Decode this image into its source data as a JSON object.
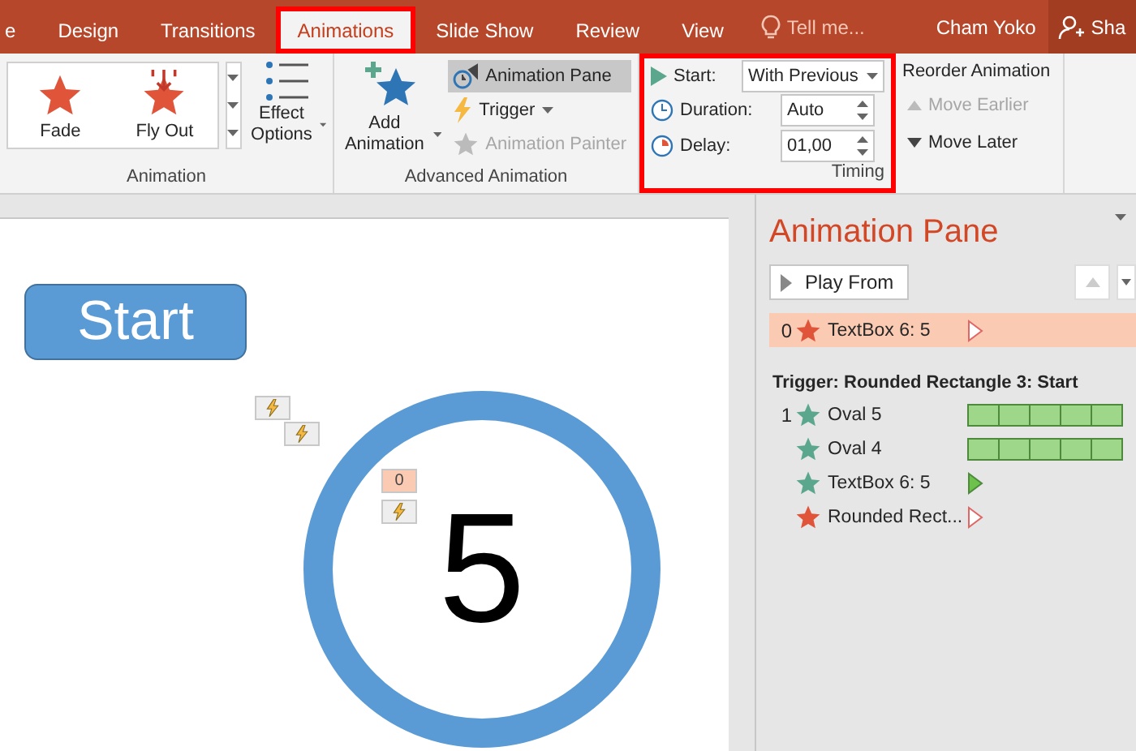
{
  "tabs": [
    {
      "label": "e",
      "selected": false,
      "highlighted": false
    },
    {
      "label": "Design",
      "selected": false,
      "highlighted": false
    },
    {
      "label": "Transitions",
      "selected": false,
      "highlighted": false
    },
    {
      "label": "Animations",
      "selected": true,
      "highlighted": true
    },
    {
      "label": "Slide Show",
      "selected": false,
      "highlighted": false
    },
    {
      "label": "Review",
      "selected": false,
      "highlighted": false
    },
    {
      "label": "View",
      "selected": false,
      "highlighted": false
    }
  ],
  "tell_me": {
    "placeholder": "Tell me..."
  },
  "user": "Cham Yoko",
  "share": "Sha",
  "animation_group": {
    "label": "Animation",
    "effects": [
      {
        "label": "Fade"
      },
      {
        "label": "Fly Out"
      }
    ],
    "effect_options": "Effect Options"
  },
  "advanced": {
    "label": "Advanced Animation",
    "add": "Add Animation",
    "items": [
      {
        "label": "Animation Pane",
        "selected": true,
        "disabled": false,
        "has_menu": false
      },
      {
        "label": "Trigger",
        "selected": false,
        "disabled": false,
        "has_menu": true
      },
      {
        "label": "Animation Painter",
        "selected": false,
        "disabled": true,
        "has_menu": false
      }
    ]
  },
  "timing": {
    "label": "Timing",
    "highlighted": true,
    "start": {
      "label": "Start:",
      "value": "With Previous"
    },
    "duration": {
      "label": "Duration:",
      "value": "Auto"
    },
    "delay": {
      "label": "Delay:",
      "value": "01,00"
    }
  },
  "reorder": {
    "title": "Reorder Animation",
    "items": [
      {
        "label": "Move Earlier",
        "disabled": true
      },
      {
        "label": "Move Later",
        "disabled": false
      }
    ]
  },
  "slide": {
    "button": "Start",
    "tag": "0",
    "number": "5"
  },
  "pane": {
    "title": "Animation Pane",
    "play": "Play From",
    "items": [
      {
        "number": "0",
        "name": "TextBox 6: 5",
        "color": "#e0553a",
        "selected": true,
        "kind": "hollow"
      }
    ],
    "trigger": "Trigger: Rounded Rectangle 3: Start",
    "trigger_items": [
      {
        "number": "1",
        "name": "Oval 5",
        "color": "#5ba78e",
        "selected": false,
        "kind": "bar"
      },
      {
        "name": "Oval 4",
        "color": "#5ba78e",
        "selected": false,
        "kind": "bar"
      },
      {
        "name": "TextBox 6: 5",
        "color": "#5ba78e",
        "selected": false,
        "kind": "arrow"
      },
      {
        "name": "Rounded Rect...",
        "color": "#e0553a",
        "selected": false,
        "kind": "hollow"
      }
    ]
  }
}
